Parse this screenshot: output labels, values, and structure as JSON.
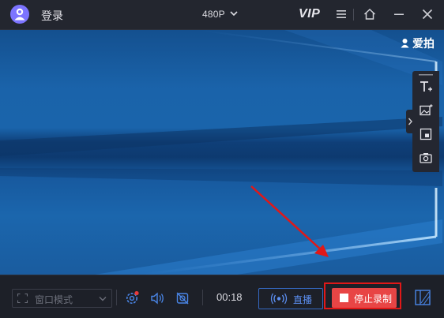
{
  "titlebar": {
    "login_label": "登录",
    "resolution": "480P",
    "vip_label": "VIP"
  },
  "preview": {
    "brand": "爱拍"
  },
  "bottombar": {
    "mode_label": "窗口模式",
    "timer": "00:18",
    "live_label": "直播",
    "stop_label": "停止录制"
  },
  "colors": {
    "accent_purple": "#7c74ff",
    "stop_red": "#e84545",
    "live_blue": "#5b8ef0",
    "highlight_red": "#e01818",
    "notify_dot": "#e83a3a"
  }
}
